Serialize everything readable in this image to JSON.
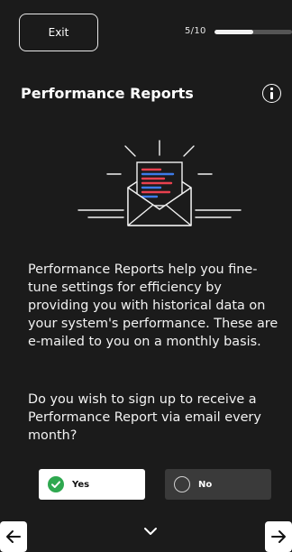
{
  "header": {
    "exit_label": "Exit",
    "progress_text": "5/10",
    "progress_fraction": 0.5
  },
  "title": "Performance Reports",
  "body": {
    "paragraph1": "Performance Reports help you fine-tune settings for efficiency by providing you with historical data on your system's performance. These are e-mailed to you on a monthly basis.",
    "paragraph2": "Do you wish to sign up to receive a Performance Report via email every month?"
  },
  "options": [
    {
      "label": "Yes",
      "selected": true
    },
    {
      "label": "No",
      "selected": false
    }
  ],
  "icons": {
    "info": "info-icon",
    "illustration": "envelope-report-icon",
    "check": "check-icon",
    "back": "arrow-left-icon",
    "expand": "chevron-down-icon",
    "next": "arrow-right-icon"
  },
  "colors": {
    "background": "#1b1b1b",
    "selected_radio": "#2ea84f",
    "chart_red": "#e8414f",
    "chart_blue": "#3d7be8",
    "unselected_option": "#3a3a3a"
  }
}
